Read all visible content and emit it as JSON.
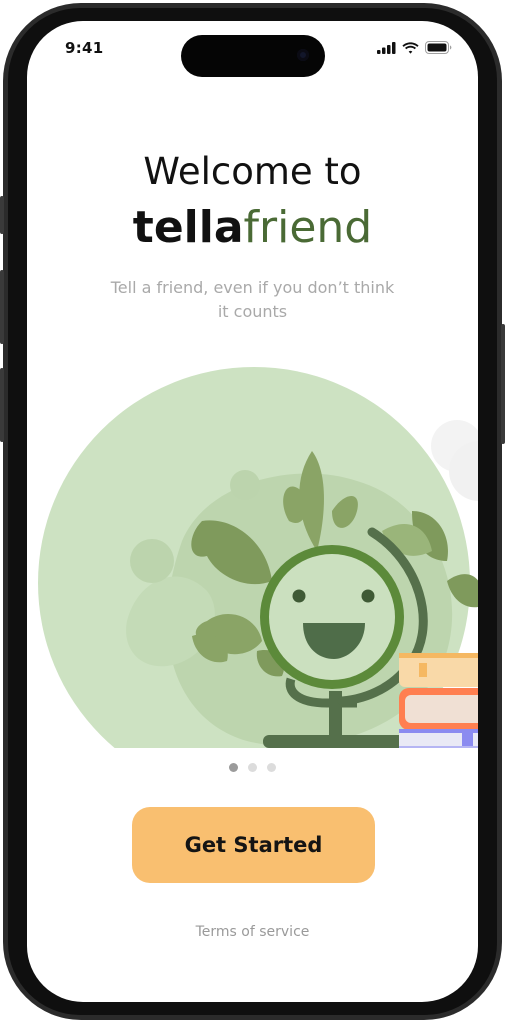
{
  "status_bar": {
    "time": "9:41"
  },
  "welcome": {
    "line1": "Welcome to",
    "brand_bold": "tella",
    "brand_rest": "friend",
    "subtitle": "Tell a friend, even if you don’t think it counts"
  },
  "pagination": {
    "count": 3,
    "active_index": 0
  },
  "cta": {
    "label": "Get Started"
  },
  "footer": {
    "terms": "Terms of service"
  },
  "colors": {
    "brand_green": "#4a6a35",
    "cta_orange": "#f9bf70",
    "illus_light_green": "#cbe0bf"
  },
  "icons": [
    "signal-icon",
    "wifi-icon",
    "battery-icon",
    "globe-illustration",
    "books-illustration",
    "leaf-illustration"
  ]
}
